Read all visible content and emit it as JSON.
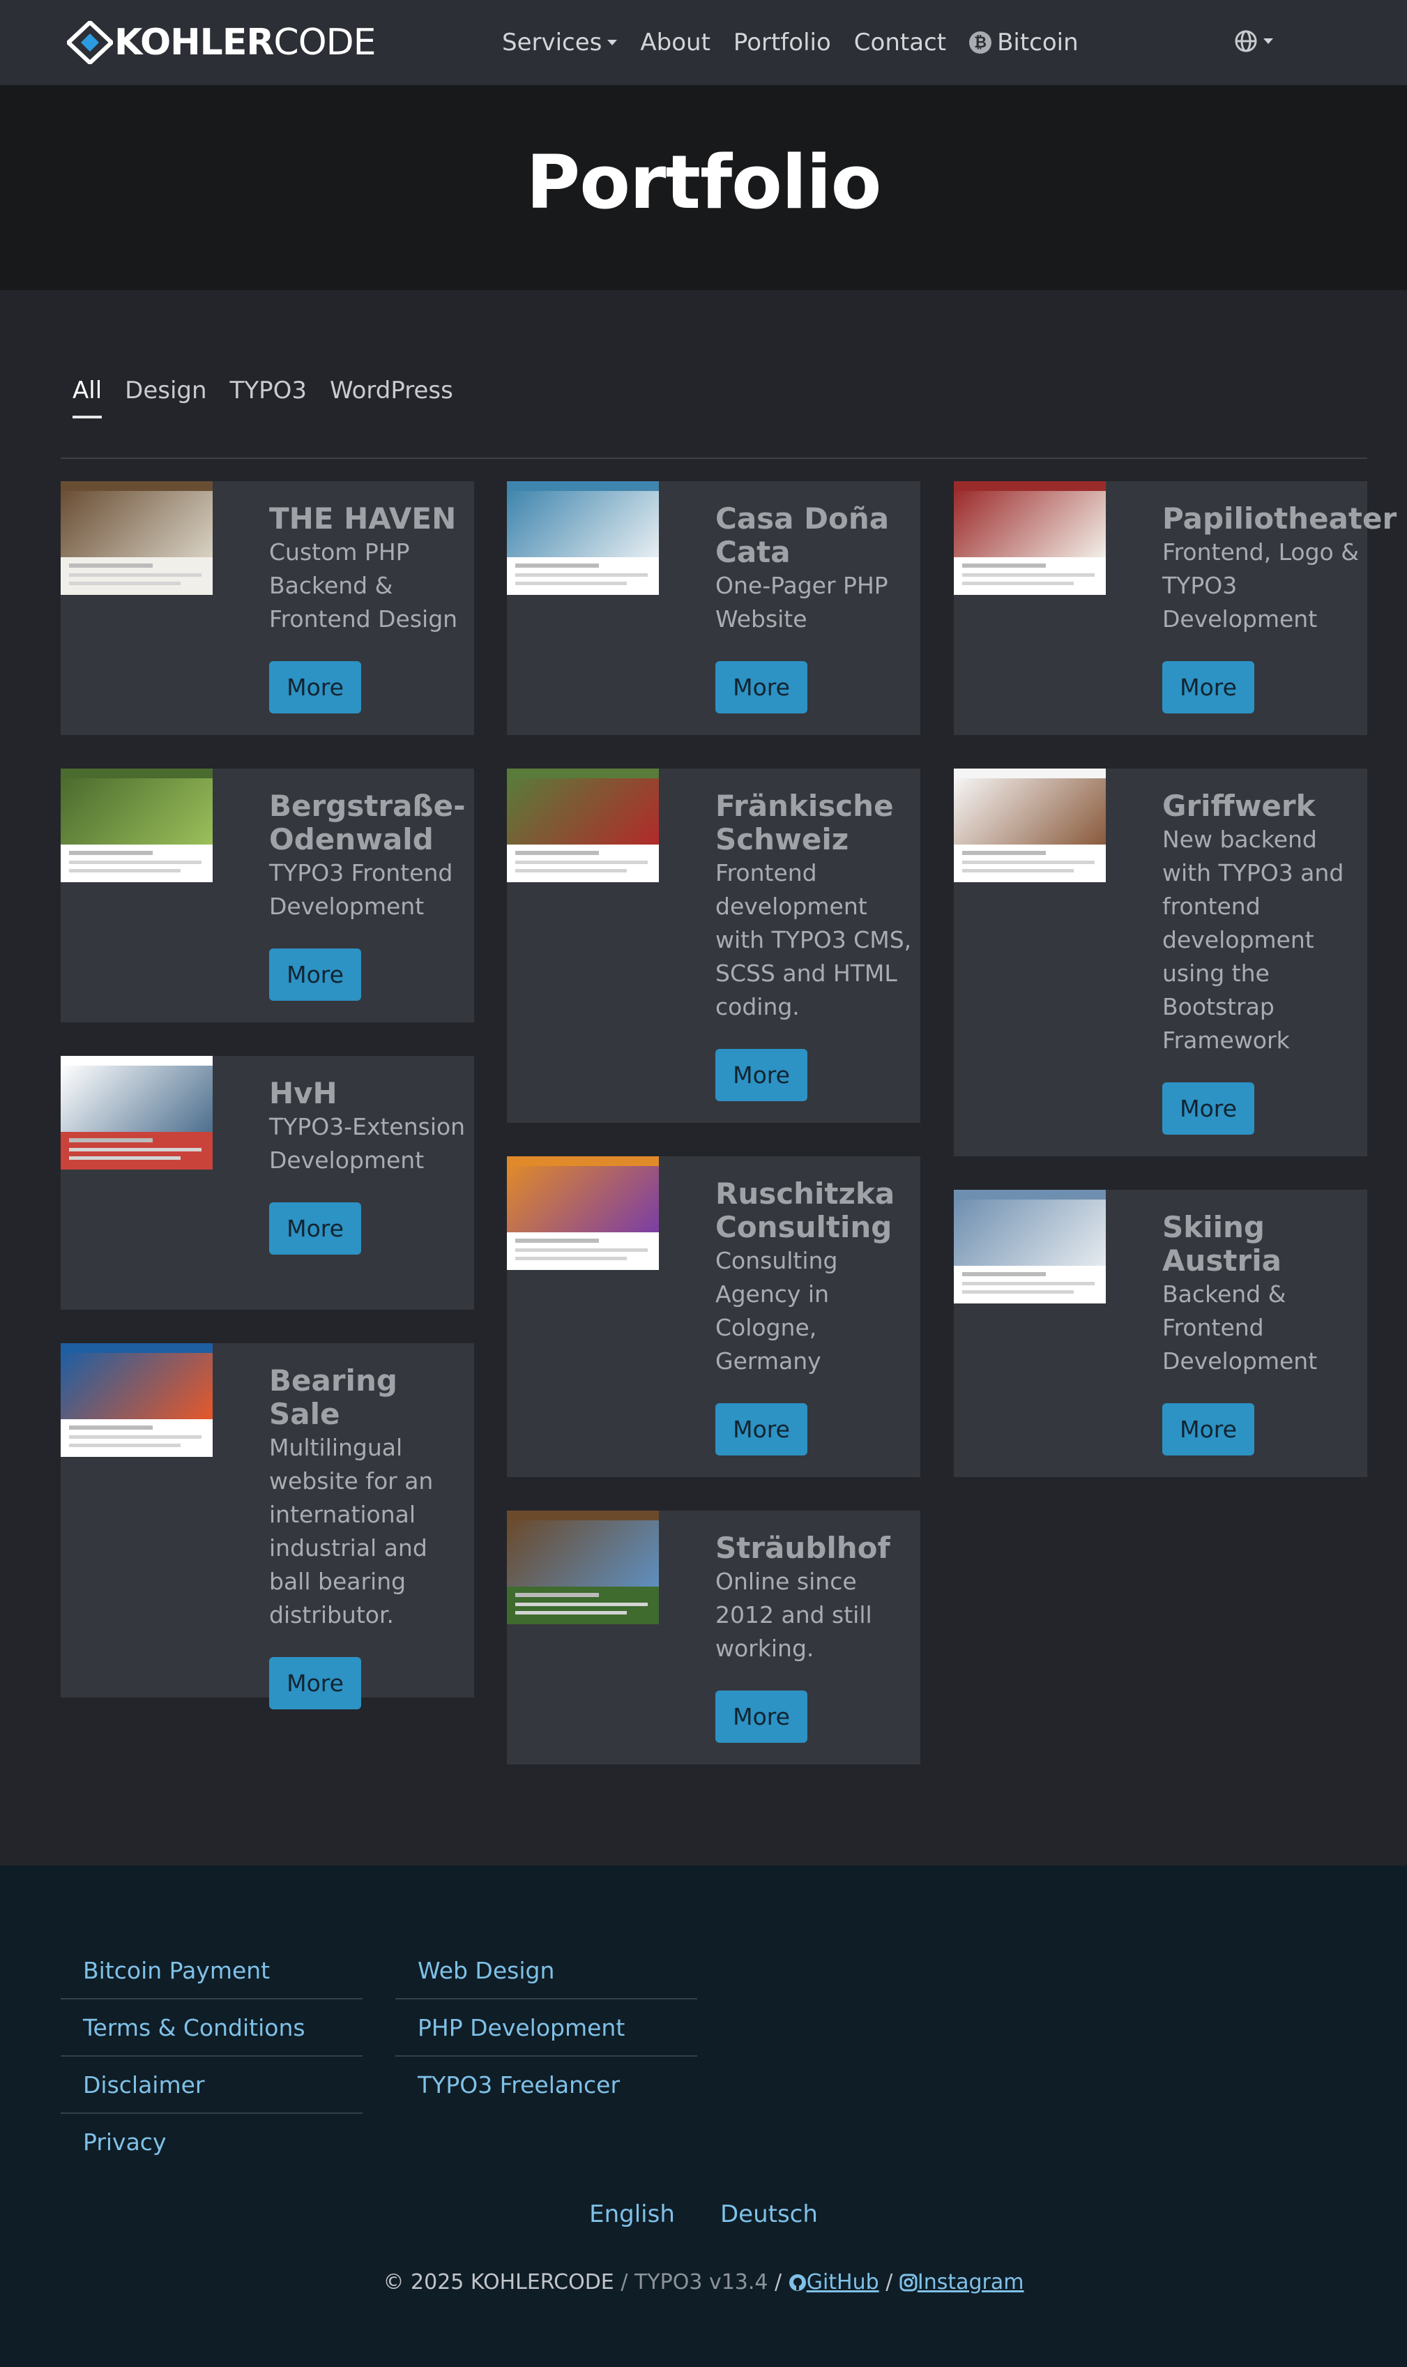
{
  "nav": {
    "brand_bold": "KOHLER",
    "brand_light": "CODE",
    "items": [
      {
        "label": "Services",
        "has_dropdown": true
      },
      {
        "label": "About"
      },
      {
        "label": "Portfolio"
      },
      {
        "label": "Contact"
      },
      {
        "label": "Bitcoin",
        "icon": "bitcoin-icon"
      }
    ],
    "language_icon": "globe-icon"
  },
  "hero": {
    "title": "Portfolio"
  },
  "filters": [
    {
      "label": "All",
      "active": true
    },
    {
      "label": "Design"
    },
    {
      "label": "TYPO3"
    },
    {
      "label": "WordPress"
    }
  ],
  "projects": [
    {
      "title": "THE HAVEN",
      "desc": "Custom PHP Backend & Frontend Design",
      "button": "More",
      "thumb_colors": [
        "#6a4e34",
        "#d8d2c4",
        "#f1efe9"
      ]
    },
    {
      "title": "Casa Doña Cata",
      "desc": "One-Pager PHP Website",
      "button": "More",
      "thumb_colors": [
        "#3f85ad",
        "#e7eef2",
        "#ffffff"
      ]
    },
    {
      "title": "Papiliotheater",
      "desc": "Frontend, Logo & TYPO3 Development",
      "button": "More",
      "thumb_colors": [
        "#9b2b2b",
        "#f2efe8",
        "#ffffff"
      ]
    },
    {
      "title": "Bergstraße-Odenwald",
      "desc": "TYPO3 Frontend Development",
      "button": "More",
      "thumb_colors": [
        "#4a6b2e",
        "#9bbf5a",
        "#ffffff"
      ]
    },
    {
      "title": "Fränkische Schweiz",
      "desc": "Frontend development with TYPO3 CMS, SCSS and HTML coding.",
      "button": "More",
      "thumb_colors": [
        "#597c3b",
        "#b22a2a",
        "#ffffff"
      ]
    },
    {
      "title": "Griffwerk",
      "desc": "New backend with TYPO3 and frontend development using the Bootstrap Framework",
      "button": "More",
      "thumb_colors": [
        "#f5f5f5",
        "#8a5a3c",
        "#ffffff"
      ]
    },
    {
      "title": "HvH",
      "desc": "TYPO3-Extension Development",
      "button": "More",
      "thumb_colors": [
        "#ffffff",
        "#4d6f8e",
        "#c9433b"
      ]
    },
    {
      "title": "Ruschitzka Consulting",
      "desc": "Consulting Agency in Cologne, Germany",
      "button": "More",
      "thumb_colors": [
        "#e08a2a",
        "#7b3ea5",
        "#ffffff"
      ]
    },
    {
      "title": "Skiing Austria",
      "desc": "Backend & Frontend Development",
      "button": "More",
      "thumb_colors": [
        "#6f8fb0",
        "#e6ebef",
        "#ffffff"
      ]
    },
    {
      "title": "Bearing Sale",
      "desc": "Multilingual website for an international industrial and ball bearing distributor.",
      "button": "More",
      "thumb_colors": [
        "#1e5fa3",
        "#e6582a",
        "#ffffff"
      ]
    },
    {
      "title": "Sträublhof",
      "desc": "Online since 2012 and still working.",
      "button": "More",
      "thumb_colors": [
        "#6b4a2b",
        "#5f8fbf",
        "#3f6b2e"
      ]
    }
  ],
  "footer": {
    "col1": [
      "Bitcoin Payment",
      "Terms & Conditions",
      "Disclaimer",
      "Privacy"
    ],
    "col2": [
      "Web Design",
      "PHP Development",
      "TYPO3 Freelancer"
    ],
    "languages": [
      "English",
      "Deutsch"
    ],
    "copyright": "© 2025 KOHLERCODE",
    "version": "TYPO3 v13.4",
    "github": "GitHub",
    "instagram": "Instagram"
  }
}
